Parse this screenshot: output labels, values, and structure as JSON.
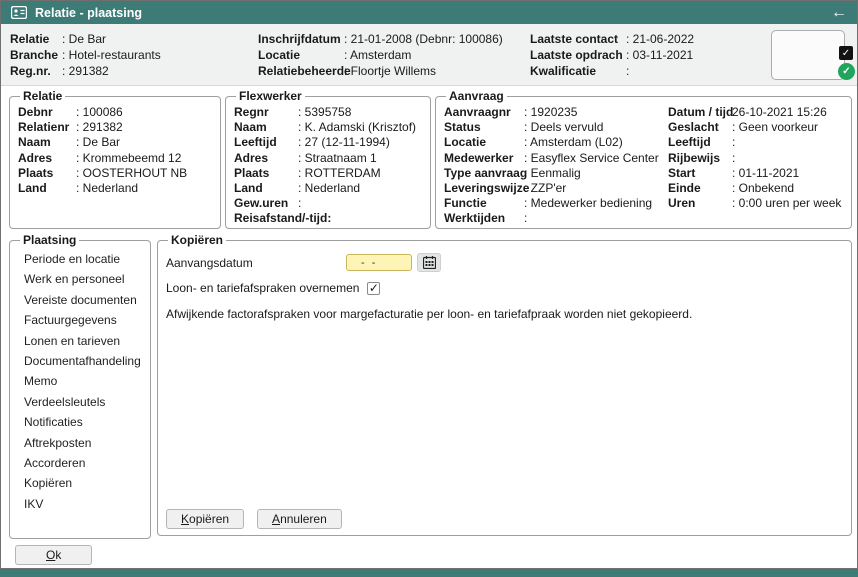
{
  "colors": {
    "teal": "#3d7b77",
    "header_bg": "#f0f1f1",
    "green_badge": "#21a45c",
    "black_badge": "#121212",
    "date_input_bg": "#fdf4b6",
    "date_input_border": "#c9b55e"
  },
  "icons": {
    "titlebar_icon": "contact-card",
    "back_arrow": "←",
    "check": "✓",
    "calendar": "calendar-grid"
  },
  "titlebar": {
    "title": "Relatie - plaatsing"
  },
  "header": {
    "col1": [
      {
        "label": "Relatie",
        "value": ": De Bar"
      },
      {
        "label": "Branche",
        "value": ": Hotel-restaurants"
      },
      {
        "label": "Reg.nr.",
        "value": ": 291382"
      }
    ],
    "col2": [
      {
        "label": "Inschrijfdatum",
        "value": ": 21-01-2008 (Debnr: 100086)"
      },
      {
        "label": "Locatie",
        "value": ": Amsterdam"
      },
      {
        "label": "Relatiebeheerde",
        "value": ": Floortje Willems"
      }
    ],
    "col3": [
      {
        "label": "Laatste contact",
        "value": ": 21-06-2022"
      },
      {
        "label": "Laatste opdrach",
        "value": ": 03-11-2021"
      },
      {
        "label": "Kwalificatie",
        "value": ":"
      }
    ]
  },
  "relatie": {
    "legend": "Relatie",
    "rows": [
      {
        "label": "Debnr",
        "value": ": 100086"
      },
      {
        "label": "Relatienr",
        "value": ": 291382"
      },
      {
        "label": "Naam",
        "value": ": De Bar"
      },
      {
        "label": "Adres",
        "value": ": Krommebeemd 12"
      },
      {
        "label": "Plaats",
        "value": ": OOSTERHOUT NB"
      },
      {
        "label": "Land",
        "value": ": Nederland"
      }
    ]
  },
  "flexwerker": {
    "legend": "Flexwerker",
    "rows": [
      {
        "label": "Regnr",
        "value": ": 5395758"
      },
      {
        "label": "Naam",
        "value": ": K. Adamski (Krisztof)"
      },
      {
        "label": "Leeftijd",
        "value": ": 27 (12-11-1994)"
      },
      {
        "label": "Adres",
        "value": ": Straatnaam 1"
      },
      {
        "label": "Plaats",
        "value": ": ROTTERDAM"
      },
      {
        "label": "Land",
        "value": ": Nederland"
      },
      {
        "label": "Gew.uren",
        "value": ":"
      },
      {
        "label": "Reisafstand/-tijd:",
        "value": ""
      }
    ]
  },
  "aanvraag": {
    "legend": "Aanvraag",
    "left": [
      {
        "label": "Aanvraagnr",
        "value": ": 1920235"
      },
      {
        "label": "Status",
        "value": ": Deels vervuld"
      },
      {
        "label": "Locatie",
        "value": ": Amsterdam (L02)"
      },
      {
        "label": "Medewerker",
        "value": ": Easyflex Service Center"
      },
      {
        "label": "Type aanvraag",
        "value": ": Eenmalig"
      },
      {
        "label": "Leveringswijze",
        "value": ": ZZP'er"
      },
      {
        "label": "Functie",
        "value": ": Medewerker bediening"
      },
      {
        "label": "Werktijden",
        "value": ":"
      }
    ],
    "right": [
      {
        "label": "Datum / tijd",
        "value": "26-10-2021 15:26"
      },
      {
        "label": "Geslacht",
        "value": ": Geen voorkeur"
      },
      {
        "label": "Leeftijd",
        "value": ":"
      },
      {
        "label": "Rijbewijs",
        "value": ":"
      },
      {
        "label": "Start",
        "value": ": 01-11-2021"
      },
      {
        "label": "Einde",
        "value": ": Onbekend"
      },
      {
        "label": "Uren",
        "value": ": 0:00 uren per week"
      }
    ]
  },
  "plaatsing": {
    "legend": "Plaatsing",
    "items": [
      "Periode en locatie",
      "Werk en personeel",
      "Vereiste documenten",
      "Factuurgegevens",
      "Lonen en tarieven",
      "Documentafhandeling",
      "Memo",
      "Verdeelsleutels",
      "Notificaties",
      "Aftrekposten",
      "Accorderen",
      "Kopiëren",
      "IKV"
    ]
  },
  "kopieren": {
    "legend": "Kopiëren",
    "aanvangsdatum_label": "Aanvangsdatum",
    "date_value": "- -",
    "checkbox_label": "Loon- en tariefafspraken overnemen",
    "checkbox_checked": "true",
    "note": "Afwijkende factorafspraken voor margefacturatie per loon- en tariefafpraak worden niet gekopieerd.",
    "copy_button": "Kopiëren",
    "cancel_button": "Annuleren"
  },
  "footer": {
    "ok_button": "Ok"
  }
}
